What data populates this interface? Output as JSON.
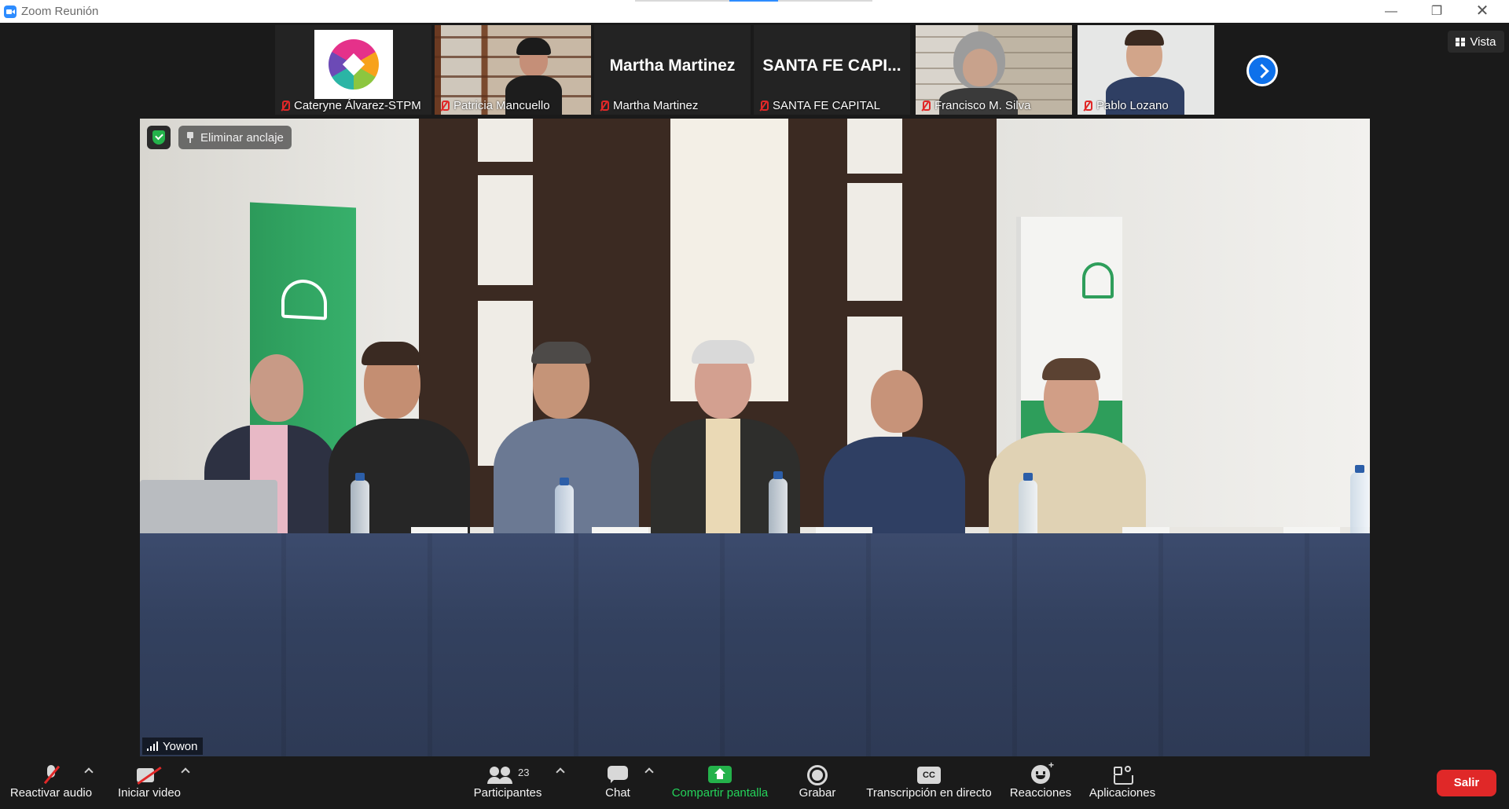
{
  "window": {
    "title": "Zoom Reunión",
    "min_glyph": "—",
    "max_glyph": "❐",
    "close_glyph": "✕"
  },
  "view_button": {
    "label": "Vista"
  },
  "participants": [
    {
      "name": "Cateryne Álvarez-STPM",
      "video": "logo",
      "muted": true
    },
    {
      "name": "Patricia Mancuello",
      "video": "camera",
      "muted": true
    },
    {
      "name": "Martha Martinez",
      "display_name": "Martha Martinez",
      "video": "off",
      "muted": true
    },
    {
      "name": "SANTA FE CAPITAL",
      "display_name": "SANTA FE CAPI...",
      "video": "off",
      "muted": true
    },
    {
      "name": "Francisco M. Silva",
      "video": "camera",
      "muted": true
    },
    {
      "name": "Pablo Lozano",
      "video": "camera",
      "muted": true
    }
  ],
  "main_video": {
    "speaker": "Yowon",
    "unpin_label": "Eliminar anclaje"
  },
  "toolbar": {
    "audio_label": "Reactivar audio",
    "video_label": "Iniciar video",
    "participants_label": "Participantes",
    "participants_count": "23",
    "chat_label": "Chat",
    "share_label": "Compartir pantalla",
    "record_label": "Grabar",
    "transcript_label": "Transcripción en directo",
    "transcript_icon": "CC",
    "reactions_label": "Reacciones",
    "apps_label": "Aplicaciones",
    "leave_label": "Salir"
  },
  "colors": {
    "accent_blue": "#0e71eb",
    "leave_red": "#e02828",
    "share_green": "#24b24b",
    "brand_green": "#2e9e5b"
  }
}
